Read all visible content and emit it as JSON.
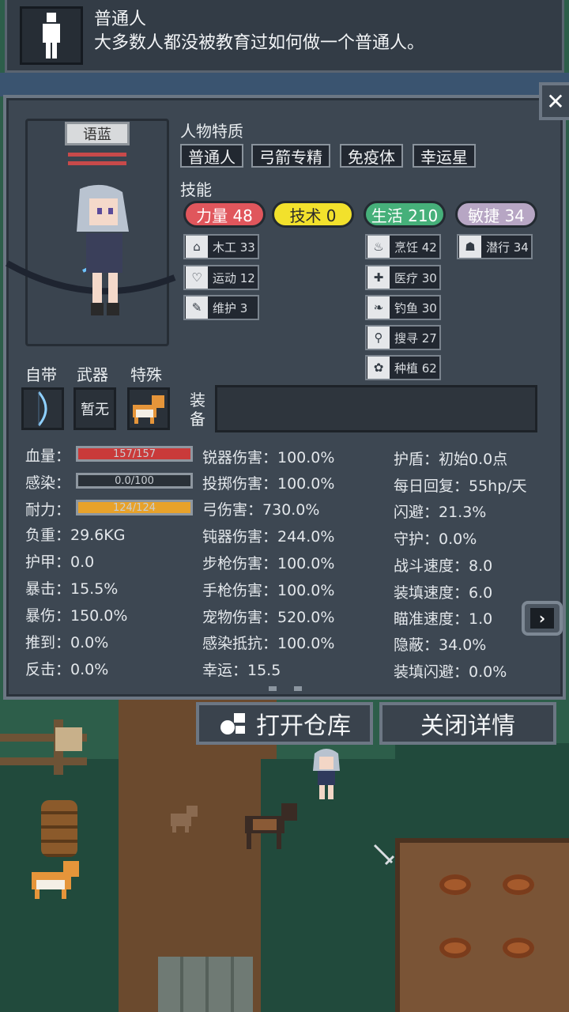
{
  "top_info": {
    "title": "普通人",
    "description": "大多数人都没被教育过如何做一个普通人。",
    "icon": "person-silhouette-icon"
  },
  "close_icon": "close-icon",
  "character": {
    "name": "语蓝",
    "sprite": "archer-girl-sprite"
  },
  "traits": {
    "label": "人物特质",
    "items": [
      "普通人",
      "弓箭专精",
      "免疫体",
      "幸运星"
    ]
  },
  "skills": {
    "label": "技能",
    "categories": [
      {
        "label": "力量 48",
        "color": "#e0565c",
        "text_color": "#ffffff"
      },
      {
        "label": "技术 0",
        "color": "#f2e12c",
        "text_color": "#2a2a2a"
      },
      {
        "label": "生活 210",
        "color": "#46b07a",
        "text_color": "#ffffff"
      },
      {
        "label": "敏捷 34",
        "color": "#b7a6c4",
        "text_color": "#ffffff"
      }
    ],
    "strength": [
      {
        "icon": "house-icon",
        "label": "木工 33"
      },
      {
        "icon": "heart-icon",
        "label": "运动 12"
      },
      {
        "icon": "wrench-icon",
        "label": "维护 3"
      }
    ],
    "life": [
      {
        "icon": "cooking-pot-icon",
        "label": "烹饪 42"
      },
      {
        "icon": "medkit-icon",
        "label": "医疗 30"
      },
      {
        "icon": "fish-icon",
        "label": "钓鱼 30"
      },
      {
        "icon": "magnifier-icon",
        "label": "搜寻 27"
      },
      {
        "icon": "flower-icon",
        "label": "种植 62"
      }
    ],
    "agility": [
      {
        "icon": "sneak-icon",
        "label": "潜行 34"
      }
    ]
  },
  "gear": {
    "labels": [
      "自带",
      "武器",
      "特殊"
    ],
    "weapon_value": "暂无",
    "equip_label": "装备"
  },
  "bars": {
    "hp": {
      "label": "血量：",
      "value": "157/157",
      "fill": 1.0,
      "color": "#c93a3a"
    },
    "infection": {
      "label": "感染：",
      "value": "0.0/100",
      "fill": 0.0,
      "color": "#7c8791"
    },
    "stamina": {
      "label": "耐力：",
      "value": "124/124",
      "fill": 1.0,
      "color": "#e8a22a"
    }
  },
  "stats_col1": [
    "负重：29.6KG",
    "护甲：0.0",
    "暴击：15.5%",
    "暴伤：150.0%",
    "推到：0.0%",
    "反击：0.0%"
  ],
  "stats_col2": [
    "锐器伤害：100.0%",
    "投掷伤害：100.0%",
    "弓伤害：730.0%",
    "钝器伤害：244.0%",
    "步枪伤害：100.0%",
    "手枪伤害：100.0%",
    "宠物伤害：520.0%",
    "感染抵抗：100.0%",
    "幸运：15.5"
  ],
  "stats_col3": [
    "护盾：初始0.0点",
    "每日回复：55hp/天",
    "闪避：21.3%",
    "守护：0.0%",
    "战斗速度：8.0",
    "装填速度：6.0",
    "瞄准速度：1.0",
    "隐蔽：34.0%",
    "装填闪避：0.0%"
  ],
  "buttons": {
    "open_storage": "打开仓库",
    "close_details": "关闭详情"
  }
}
